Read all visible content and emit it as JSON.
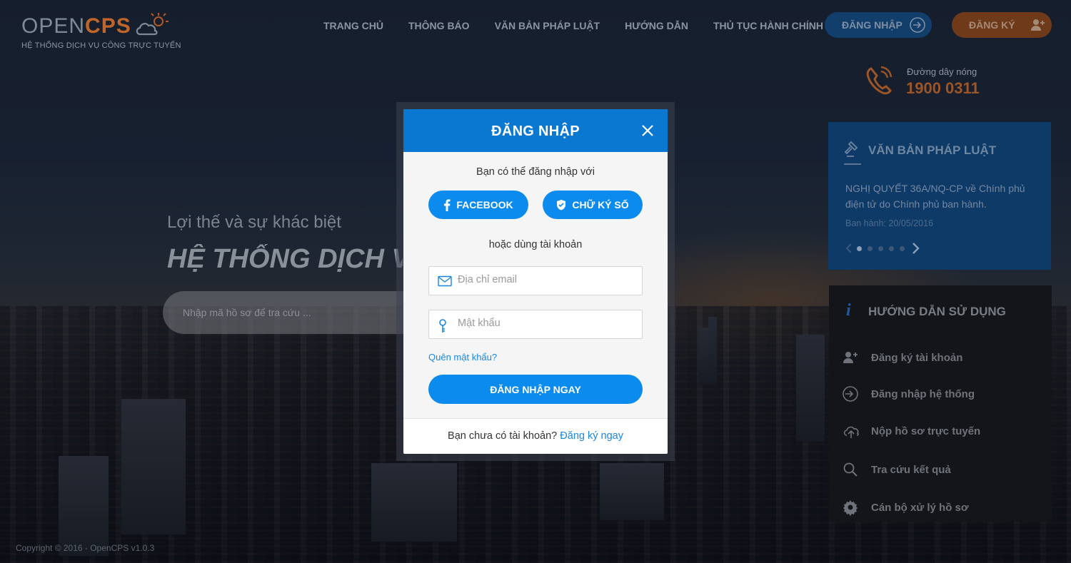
{
  "logo": {
    "open": "OPEN",
    "cps": "CPS",
    "tagline": "HỆ THỐNG DỊCH VỤ CÔNG TRỰC TUYẾN"
  },
  "nav": {
    "items": [
      {
        "label": "TRANG CHỦ"
      },
      {
        "label": "THÔNG BÁO"
      },
      {
        "label": "VĂN BẢN PHÁP LUẬT"
      },
      {
        "label": "HƯỚNG DẪN"
      },
      {
        "label": "THỦ TỤC HÀNH CHÍNH"
      }
    ],
    "login_label": "ĐĂNG NHẬP",
    "register_label": "ĐĂNG KÝ"
  },
  "hotline": {
    "label": "Đường dây nóng",
    "number": "1900 0311"
  },
  "hero": {
    "subtitle": "Lợi thế và sự khác biệt",
    "title": "HỆ THỐNG DỊCH VỤ CÔNG TRỰC TUYẾN",
    "search_placeholder": "Nhập mã hồ sơ để tra cứu ..."
  },
  "legal_panel": {
    "title": "VĂN BẢN PHÁP LUẬT",
    "doc_text": "NGHỊ QUYẾT 36A/NQ-CP về Chính phủ điện tử do Chính phủ ban hành.",
    "date": "Ban hành: 20/05/2016",
    "dots": 5,
    "active_dot": 0
  },
  "guide_panel": {
    "title": "HƯỚNG DẪN SỬ DỤNG",
    "items": [
      {
        "label": "Đăng ký tài khoản",
        "icon": "user-plus-icon"
      },
      {
        "label": "Đăng nhập hệ thống",
        "icon": "login-icon"
      },
      {
        "label": "Nộp hồ sơ trực tuyến",
        "icon": "cloud-upload-icon"
      },
      {
        "label": "Tra cứu kết quả",
        "icon": "search-icon"
      },
      {
        "label": "Cán bộ xử lý hồ sơ",
        "icon": "gear-icon"
      }
    ]
  },
  "footer": {
    "copyright": "Copyright © 2016 - OpenCPS v1.0.3"
  },
  "modal": {
    "title": "ĐĂNG NHẬP",
    "intro": "Bạn có thể đăng nhập với",
    "facebook_label": "FACEBOOK",
    "signature_label": "CHỮ KÝ SỐ",
    "or_text": "hoặc dùng tài khoản",
    "email_placeholder": "Địa chỉ email",
    "password_placeholder": "Mật khẩu",
    "forgot_label": "Quên mật khẩu?",
    "submit_label": "ĐĂNG NHẬP NGAY",
    "footer_text": "Bạn chưa có tài khoản?",
    "footer_link": "Đăng ký ngay"
  },
  "colors": {
    "primary": "#0c8bee",
    "header_blue": "#0a77d1",
    "accent_orange": "#c0662a"
  }
}
